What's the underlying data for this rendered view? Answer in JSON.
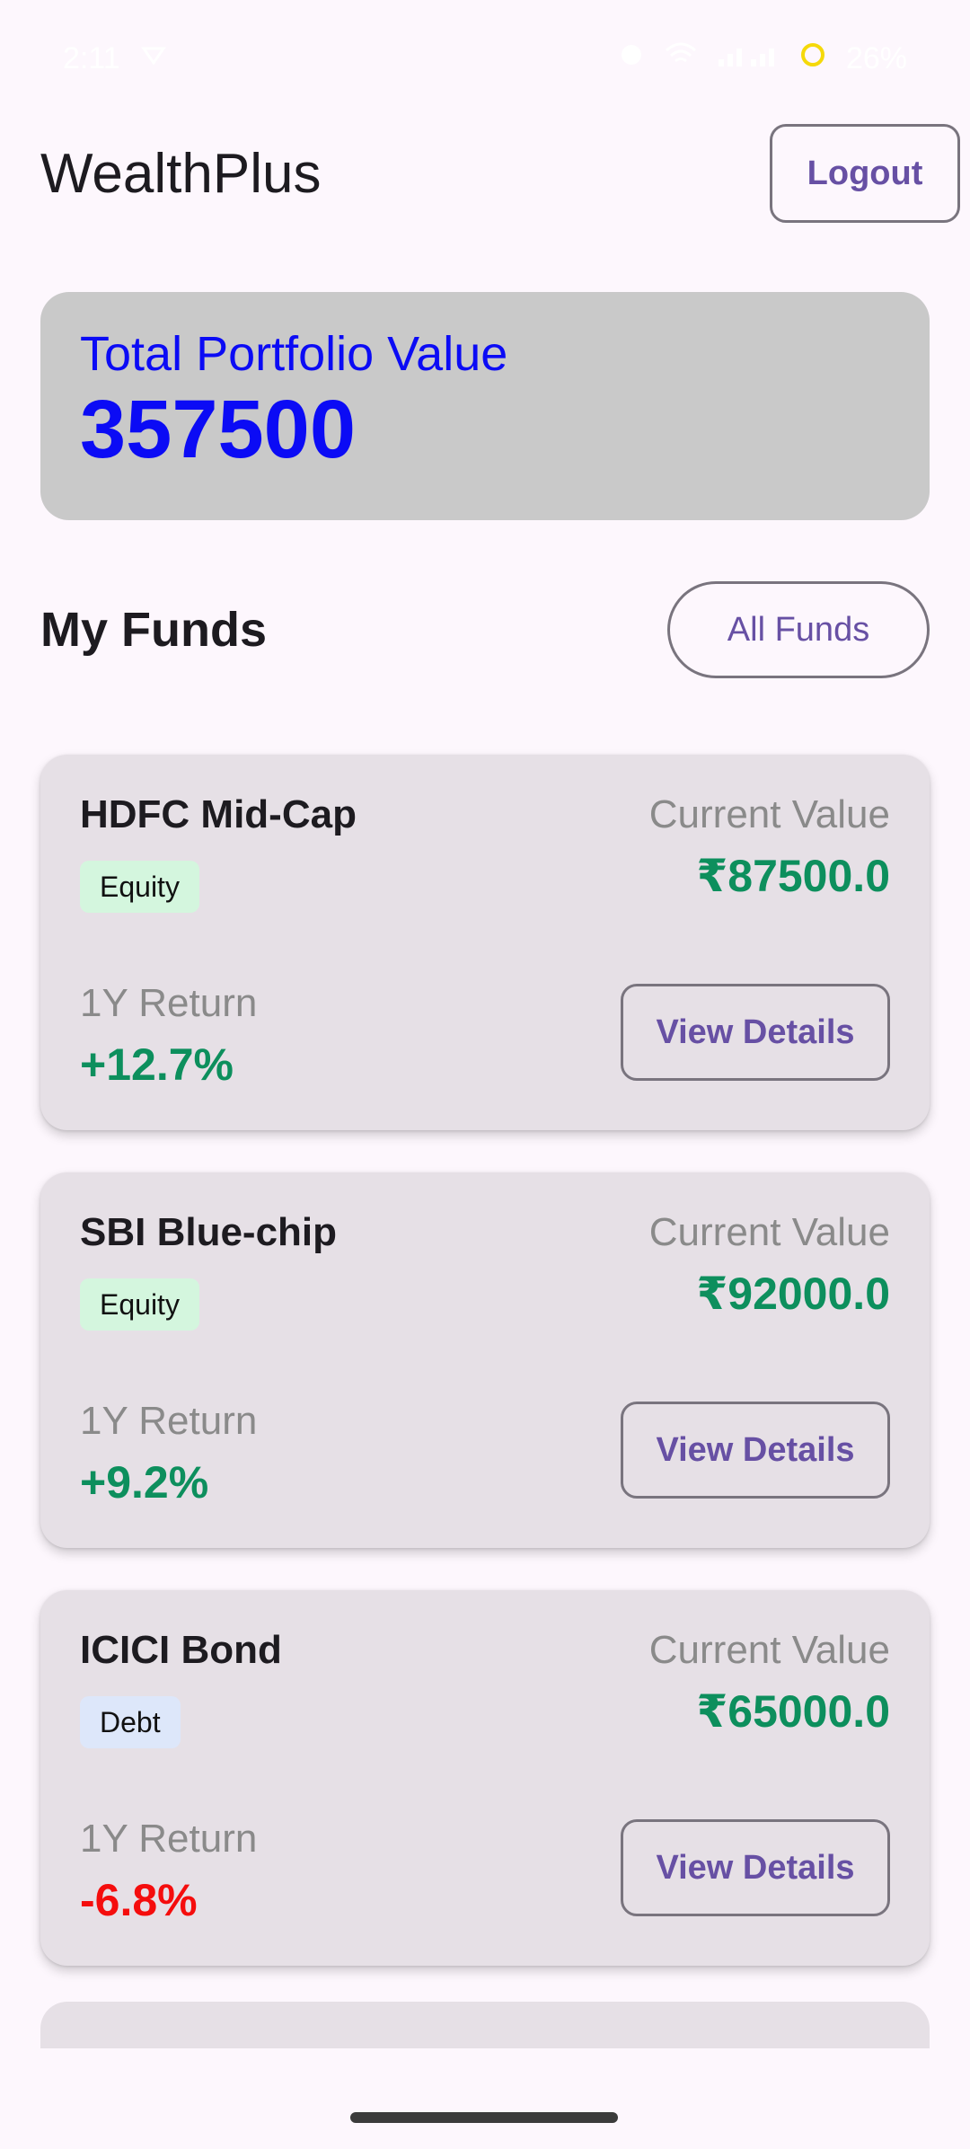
{
  "status_bar": {
    "time": "2:11",
    "battery": "26%",
    "colors": {
      "text": "#ffffff"
    }
  },
  "header": {
    "title": "WealthPlus",
    "logout_label": "Logout"
  },
  "portfolio": {
    "label": "Total Portfolio Value",
    "value": "357500"
  },
  "funds_section": {
    "title": "My Funds",
    "all_funds_label": "All Funds"
  },
  "funds": [
    {
      "name": "HDFC Mid-Cap",
      "category": "Equity",
      "current_value_label": "Current Value",
      "current_value": "₹87500.0",
      "return_label": "1Y Return",
      "return": "+12.7%",
      "view_label": "View Details"
    },
    {
      "name": "SBI Blue-chip",
      "category": "Equity",
      "current_value_label": "Current Value",
      "current_value": "₹92000.0",
      "return_label": "1Y Return",
      "return": "+9.2%",
      "view_label": "View Details"
    },
    {
      "name": "ICICI Bond",
      "category": "Debt",
      "current_value_label": "Current Value",
      "current_value": "₹65000.0",
      "return_label": "1Y Return",
      "return": "-6.8%",
      "view_label": "View Details"
    }
  ],
  "colors": {
    "accent": "#6750a4",
    "positive": "#0d8f5d",
    "negative": "#f50d0d",
    "portfolio_text": "#0b0bf5",
    "background": "#fdf7fd"
  }
}
